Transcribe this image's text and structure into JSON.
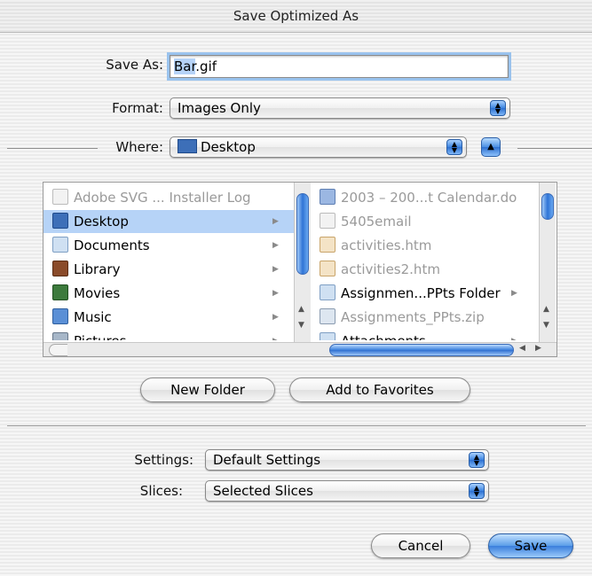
{
  "window": {
    "title": "Save Optimized As"
  },
  "save_as": {
    "label": "Save As:",
    "value_selected": "Bar",
    "value_rest": ".gif"
  },
  "format": {
    "label": "Format:",
    "value": "Images Only"
  },
  "where": {
    "label": "Where:",
    "value": "Desktop"
  },
  "browser": {
    "left_column": [
      {
        "name": "Adobe SVG ... Installer Log",
        "icon": "document-icon",
        "dim": true,
        "has_children": false,
        "selected": false
      },
      {
        "name": "Desktop",
        "icon": "desktop-icon",
        "dim": false,
        "has_children": true,
        "selected": true
      },
      {
        "name": "Documents",
        "icon": "folder-icon",
        "dim": false,
        "has_children": true,
        "selected": false
      },
      {
        "name": "Library",
        "icon": "library-folder-icon",
        "dim": false,
        "has_children": true,
        "selected": false
      },
      {
        "name": "Movies",
        "icon": "movies-folder-icon",
        "dim": false,
        "has_children": true,
        "selected": false
      },
      {
        "name": "Music",
        "icon": "music-folder-icon",
        "dim": false,
        "has_children": true,
        "selected": false
      },
      {
        "name": "Pictures",
        "icon": "pictures-folder-icon",
        "dim": false,
        "has_children": true,
        "selected": false
      }
    ],
    "right_column": [
      {
        "name": "2003 – 200...t Calendar.do",
        "icon": "word-document-icon",
        "dim": true,
        "has_children": false
      },
      {
        "name": "5405email",
        "icon": "document-icon",
        "dim": true,
        "has_children": false
      },
      {
        "name": "activities.htm",
        "icon": "html-file-icon",
        "dim": true,
        "has_children": false
      },
      {
        "name": "activities2.htm",
        "icon": "html-file-icon",
        "dim": true,
        "has_children": false
      },
      {
        "name": "Assignmen...PPts Folder",
        "icon": "folder-icon",
        "dim": false,
        "has_children": true
      },
      {
        "name": "Assignments_PPts.zip",
        "icon": "zip-archive-icon",
        "dim": true,
        "has_children": false
      },
      {
        "name": "Attachments",
        "icon": "folder-icon",
        "dim": false,
        "has_children": true
      }
    ]
  },
  "buttons": {
    "new_folder": "New Folder",
    "add_to_favorites": "Add to Favorites",
    "cancel": "Cancel",
    "save": "Save"
  },
  "settings": {
    "label": "Settings:",
    "value": "Default Settings"
  },
  "slices": {
    "label": "Slices:",
    "value": "Selected Slices"
  },
  "colors": {
    "accent": "#3a7fdc",
    "selection": "#b6d3f7",
    "focus_ring": "#9ac3ee"
  }
}
